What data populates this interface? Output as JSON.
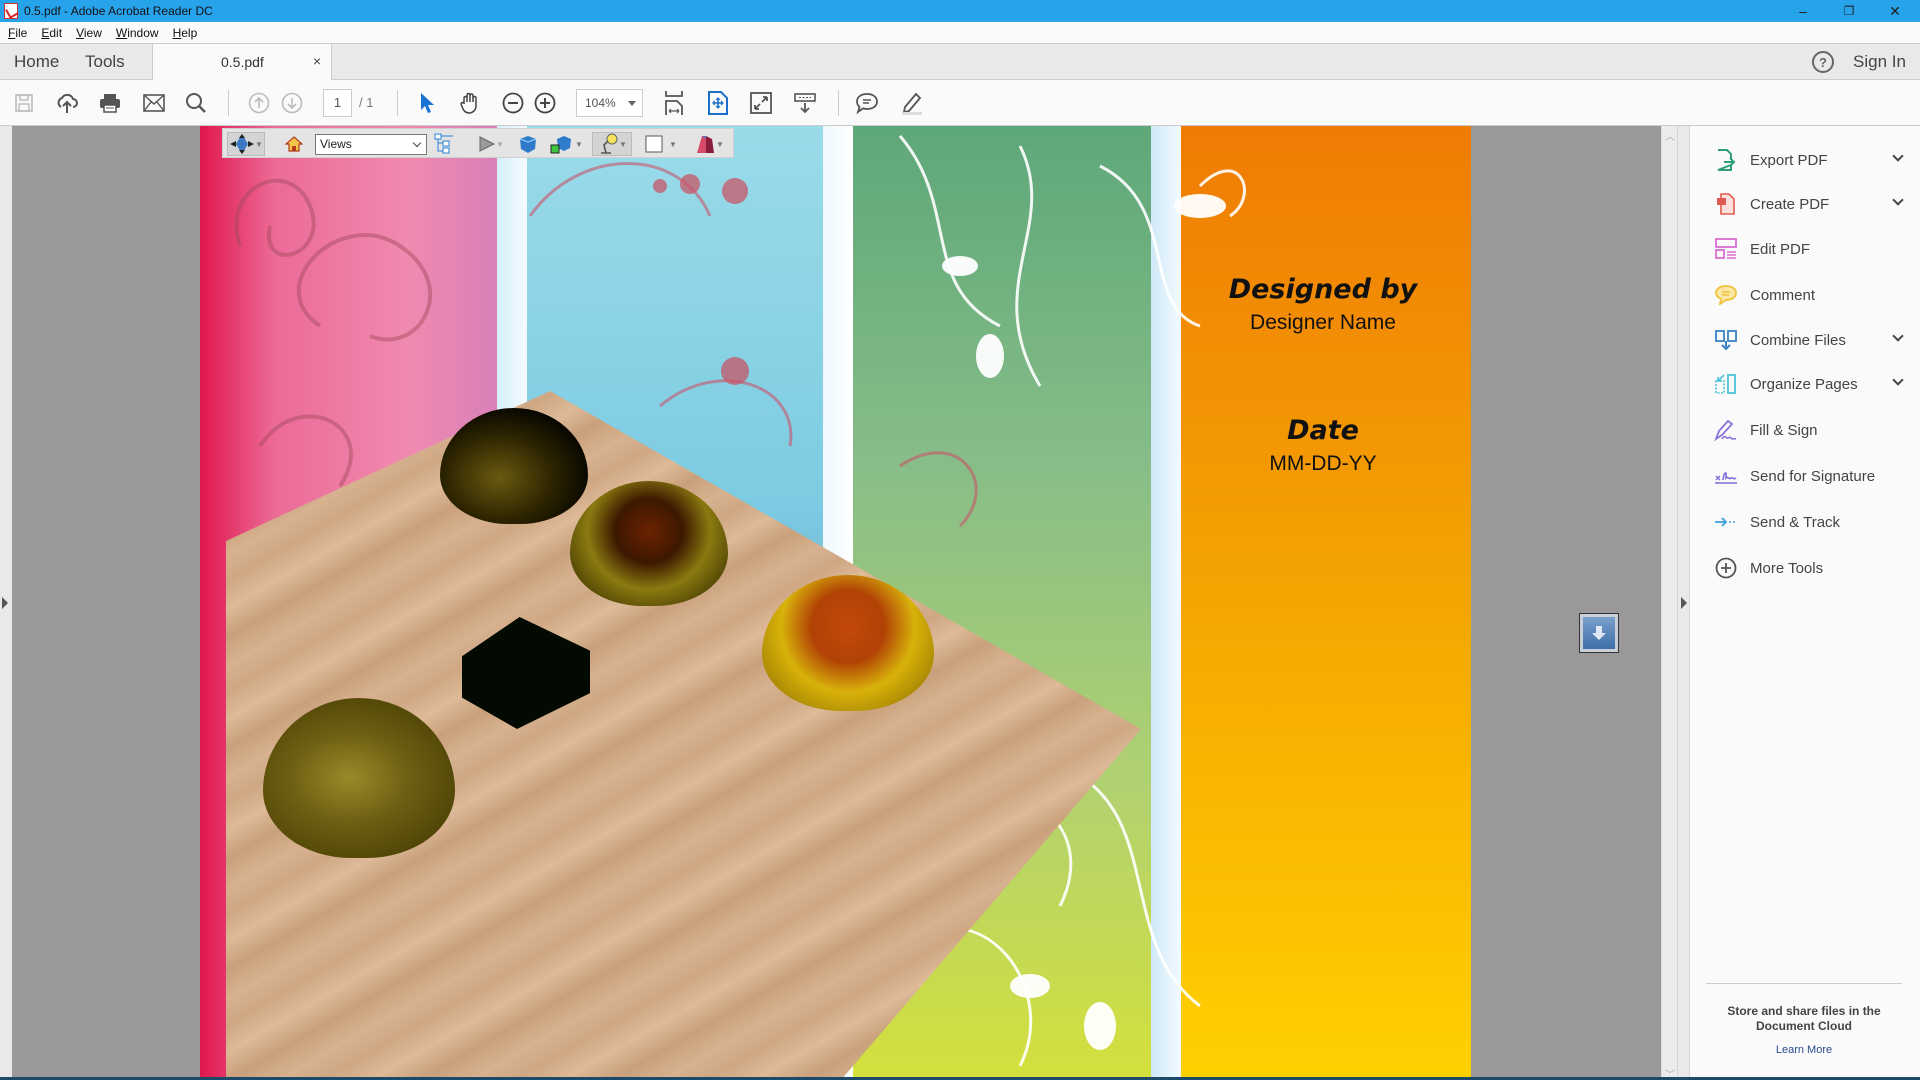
{
  "window": {
    "title": "0.5.pdf - Adobe Acrobat Reader DC",
    "controls": {
      "minimize": "–",
      "restore": "❐",
      "close": "✕"
    }
  },
  "menu": [
    "File",
    "Edit",
    "View",
    "Window",
    "Help"
  ],
  "tabs": {
    "home": "Home",
    "tools": "Tools",
    "document": "0.5.pdf",
    "close_glyph": "×",
    "help_glyph": "?",
    "sign_in": "Sign In"
  },
  "toolbar": {
    "current_page": "1",
    "total_pages": "/ 1",
    "zoom": "104%"
  },
  "toolbar3d": {
    "views_value": "Views"
  },
  "document": {
    "designed_by_label": "Designed by",
    "designer_name": "Designer Name",
    "date_label": "Date",
    "date_value": "MM-DD-YY"
  },
  "tools_panel": {
    "items": [
      {
        "label": "Export PDF",
        "icon": "export-pdf-icon",
        "color": "#2e9e77",
        "has_chevron": true
      },
      {
        "label": "Create PDF",
        "icon": "create-pdf-icon",
        "color": "#e05b4f",
        "has_chevron": true
      },
      {
        "label": "Edit PDF",
        "icon": "edit-pdf-icon",
        "color": "#d96fd1",
        "has_chevron": false
      },
      {
        "label": "Comment",
        "icon": "comment-icon",
        "color": "#f0c23c",
        "has_chevron": false
      },
      {
        "label": "Combine Files",
        "icon": "combine-files-icon",
        "color": "#3b82c8",
        "has_chevron": true
      },
      {
        "label": "Organize Pages",
        "icon": "organize-pages-icon",
        "color": "#4cc3d6",
        "has_chevron": true
      },
      {
        "label": "Fill & Sign",
        "icon": "fill-sign-icon",
        "color": "#8a74d8",
        "has_chevron": false
      },
      {
        "label": "Send for Signature",
        "icon": "send-signature-icon",
        "color": "#7b6fd6",
        "has_chevron": false
      },
      {
        "label": "Send & Track",
        "icon": "send-track-icon",
        "color": "#3aa0d8",
        "has_chevron": false
      },
      {
        "label": "More Tools",
        "icon": "more-tools-icon",
        "color": "#555555",
        "has_chevron": false
      }
    ],
    "cloud_message": "Store and share files in the Document Cloud",
    "learn_more": "Learn More"
  }
}
